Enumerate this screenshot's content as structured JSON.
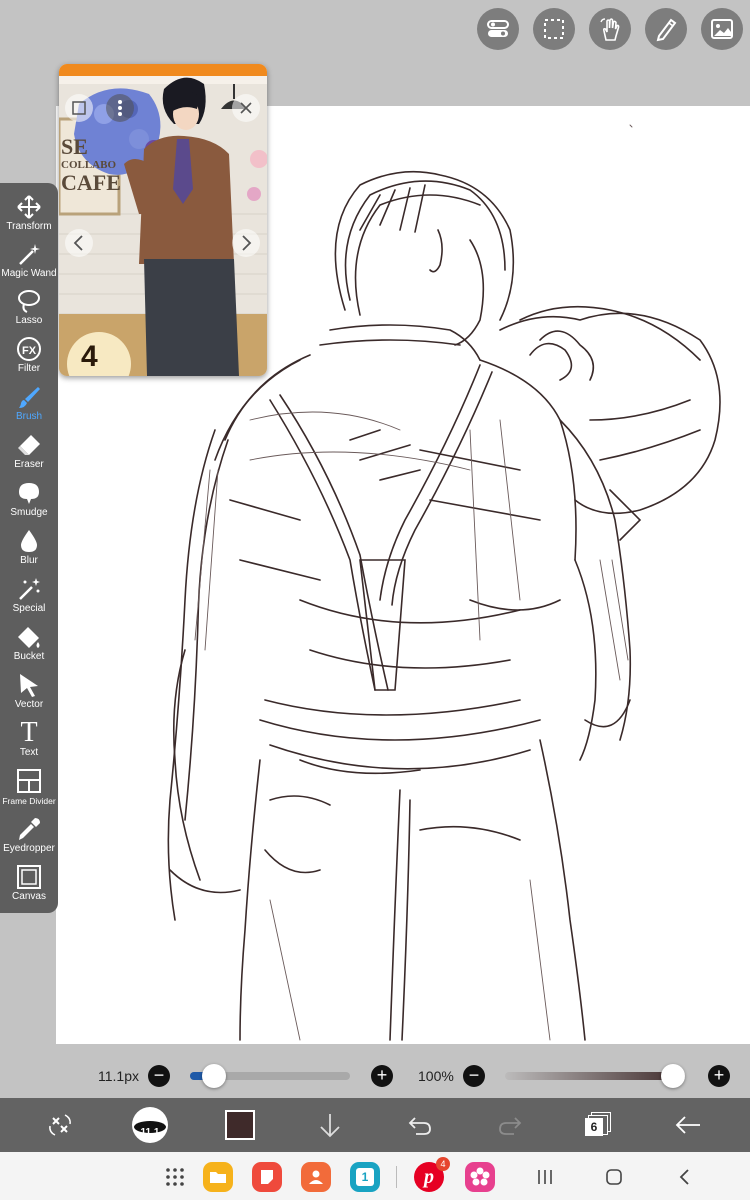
{
  "toolbar": {
    "tools": [
      {
        "label": "Transform",
        "icon": "transform-icon"
      },
      {
        "label": "Magic Wand",
        "icon": "magic-wand-icon"
      },
      {
        "label": "Lasso",
        "icon": "lasso-icon"
      },
      {
        "label": "Filter",
        "icon": "filter-fx-icon"
      },
      {
        "label": "Brush",
        "icon": "brush-icon",
        "active": true
      },
      {
        "label": "Eraser",
        "icon": "eraser-icon"
      },
      {
        "label": "Smudge",
        "icon": "smudge-icon"
      },
      {
        "label": "Blur",
        "icon": "blur-drop-icon"
      },
      {
        "label": "Special",
        "icon": "special-wand-icon"
      },
      {
        "label": "Bucket",
        "icon": "bucket-icon"
      },
      {
        "label": "Vector",
        "icon": "vector-cursor-icon"
      },
      {
        "label": "Text",
        "icon": "text-t-icon"
      },
      {
        "label": "Frame Divider",
        "icon": "frame-divider-icon"
      },
      {
        "label": "Eyedropper",
        "icon": "eyedropper-icon"
      },
      {
        "label": "Canvas",
        "icon": "canvas-icon"
      }
    ],
    "fx_text": "FX",
    "text_glyph": "T"
  },
  "top_buttons": [
    "toggle-icon",
    "selection-icon",
    "gesture-hand-icon",
    "pencil-ruler-icon",
    "image-icon"
  ],
  "reference": {
    "sign_lines": [
      "SE",
      "COLLABO",
      "CAFE"
    ],
    "badge_text": "4"
  },
  "sliders": {
    "brush_size": "11.1px",
    "brush_size_fraction": 0.09,
    "opacity": "100%",
    "opacity_fraction": 1.0
  },
  "bottom_bar": {
    "layer_count": "6",
    "brush_preview_label": "11.1",
    "color": "#3f2a2a"
  },
  "navbar": {
    "pinterest_badge": "4",
    "calendar_day": "1"
  },
  "colors": {
    "accent": "#4fa8ff",
    "toolbar_bg": "#5e5e5e",
    "ink": "#3a2a2a"
  }
}
